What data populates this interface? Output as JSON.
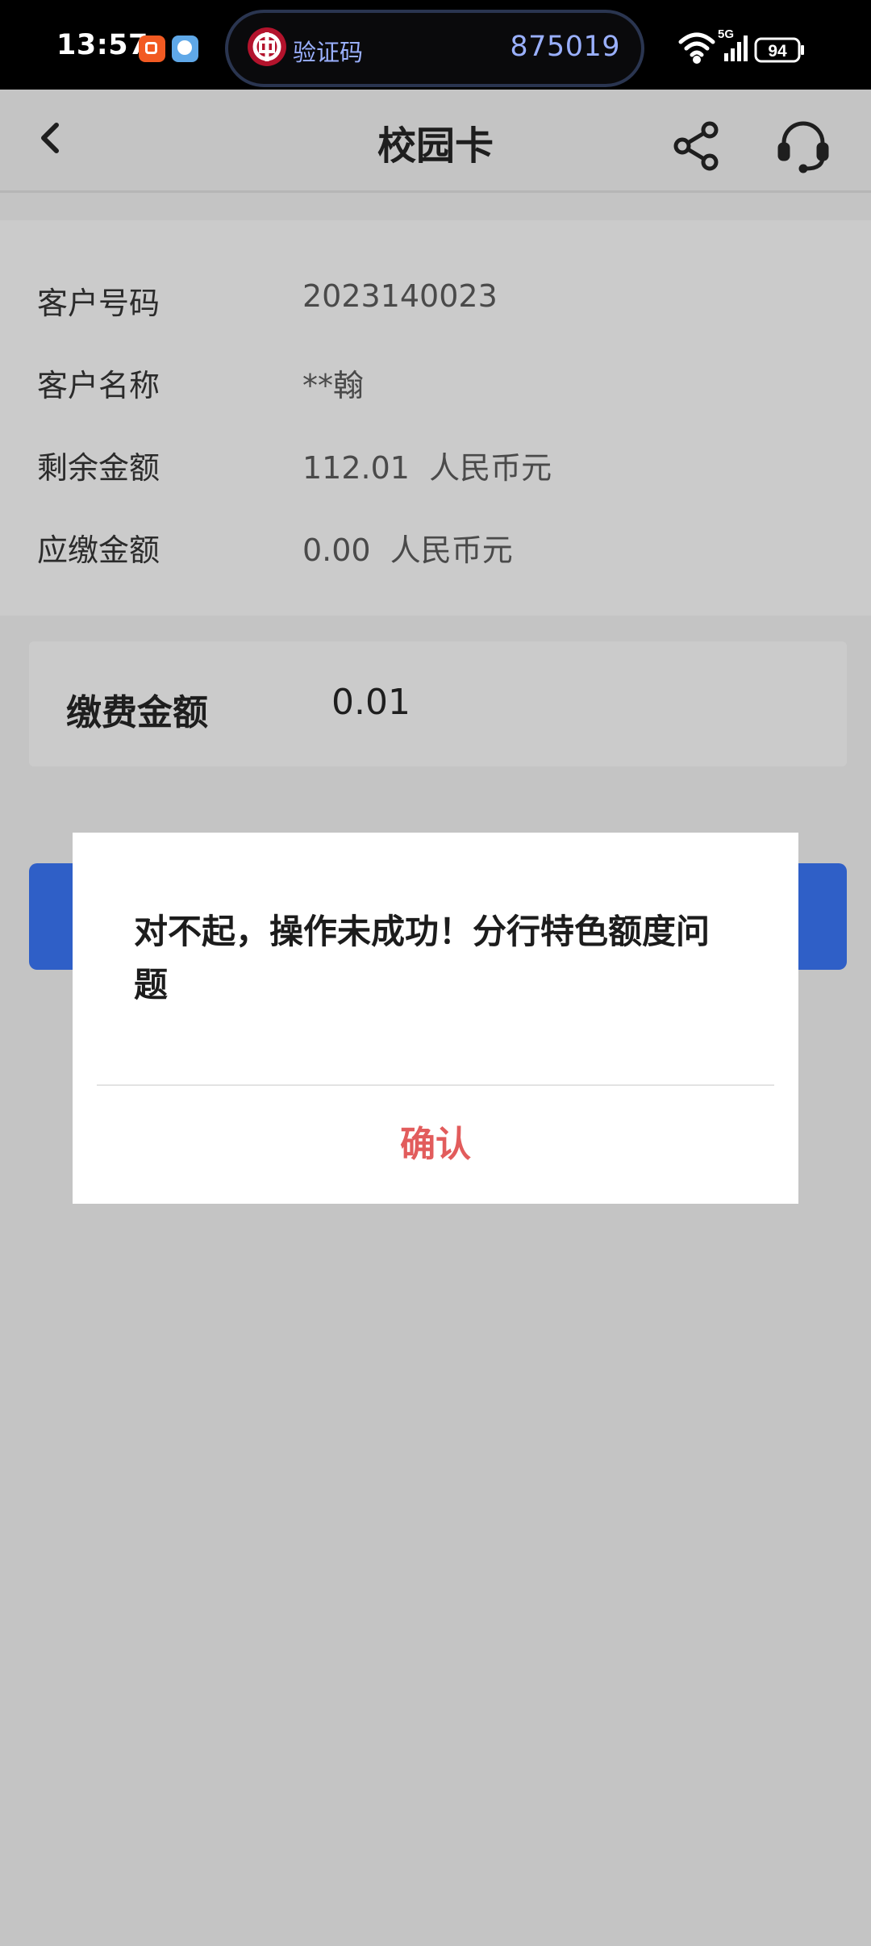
{
  "status_bar": {
    "time": "13:57",
    "verify_label": "验证码",
    "verify_code": "875019",
    "network": "5G",
    "battery": "94",
    "icons": [
      "orange-app-icon",
      "blue-app-icon",
      "boc-logo-icon",
      "wifi-icon",
      "signal-icon",
      "battery-icon"
    ]
  },
  "nav": {
    "title": "校园卡",
    "icons": [
      "back-arrow-icon",
      "share-icon",
      "customer-service-icon"
    ]
  },
  "info": {
    "rows": [
      {
        "label": "客户号码",
        "value": "2023140023"
      },
      {
        "label": "客户名称",
        "value": "**翰"
      },
      {
        "label": "剩余金额",
        "value": "112.01  人民币元"
      },
      {
        "label": "应缴金额",
        "value": "0.00  人民币元"
      }
    ]
  },
  "payment": {
    "label": "缴费金额",
    "value": "0.01"
  },
  "dialog": {
    "message": "对不起，操作未成功！分行特色额度问题",
    "confirm_label": "确认"
  },
  "colors": {
    "accent_blue": "#2f5fc7",
    "confirm_red": "#e25c5c",
    "verify_text": "#9ab0ff",
    "boc_red": "#b3132c"
  }
}
